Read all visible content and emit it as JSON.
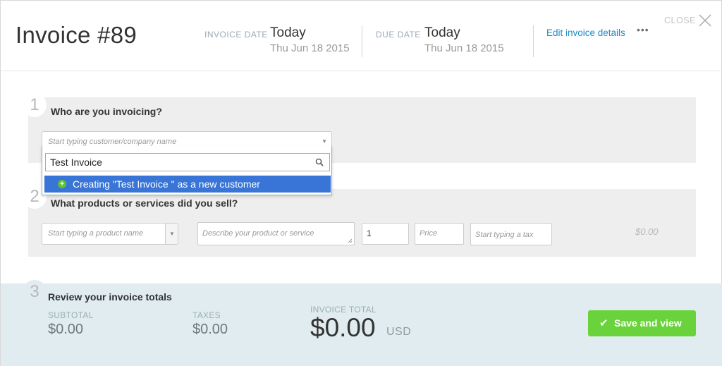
{
  "header": {
    "title": "Invoice #89",
    "invoice_date_label": "INVOICE DATE",
    "invoice_date_value": "Today",
    "invoice_date_sub": "Thu Jun 18 2015",
    "due_date_label": "DUE DATE",
    "due_date_value": "Today",
    "due_date_sub": "Thu Jun 18 2015",
    "edit_link": "Edit invoice details",
    "more_label": "•••",
    "close_label": "CLOSE"
  },
  "section1": {
    "number": "1",
    "title": "Who are you invoicing?",
    "customer_placeholder": "Start typing customer/company name",
    "search_value": "Test Invoice",
    "option_label": "Creating \"Test Invoice \" as a new customer"
  },
  "section2": {
    "number": "2",
    "title": "What products or services did you sell?",
    "product_placeholder": "Start typing a product name",
    "description_placeholder": "Describe your product or service",
    "quantity": "1",
    "price_placeholder": "Price",
    "tax_placeholder": "Start typing a tax",
    "line_amount": "$0.00"
  },
  "section3": {
    "number": "3",
    "title": "Review your invoice totals",
    "subtotal_label": "SUBTOTAL",
    "subtotal_value": "$0.00",
    "taxes_label": "TAXES",
    "taxes_value": "$0.00",
    "total_label": "INVOICE TOTAL",
    "total_value": "$0.00",
    "currency": "USD",
    "save_label": "Save and view"
  },
  "icons": {
    "close": "close-icon",
    "search": "search-icon",
    "plus": "plus-circle-icon",
    "check": "check-icon",
    "chevron": "chevron-down-icon"
  },
  "colors": {
    "accent_link": "#1e8bc3",
    "highlight": "#3875d7",
    "save_button": "#6ad33b",
    "totals_bg": "#e0ecef"
  }
}
